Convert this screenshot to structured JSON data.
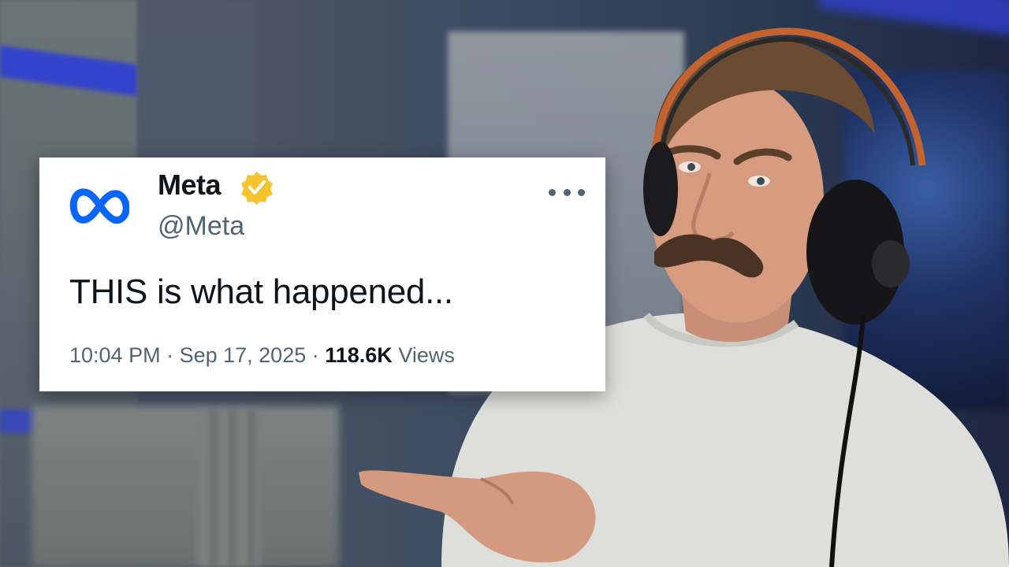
{
  "tweet": {
    "author_name": "Meta",
    "handle": "@Meta",
    "verified": true,
    "verified_badge_color": "#f4c430",
    "logo": "meta-infinity-logo",
    "logo_color": "#0866ff",
    "text": "THIS is what happened...",
    "time": "10:04 PM",
    "separator": " · ",
    "date": "Sep 17, 2025",
    "views_count": "118.6K",
    "views_label": " Views",
    "more_icon": "more-horizontal-icon"
  },
  "scene": {
    "presenter": "man with mustache and headphones pointing at the tweet"
  }
}
